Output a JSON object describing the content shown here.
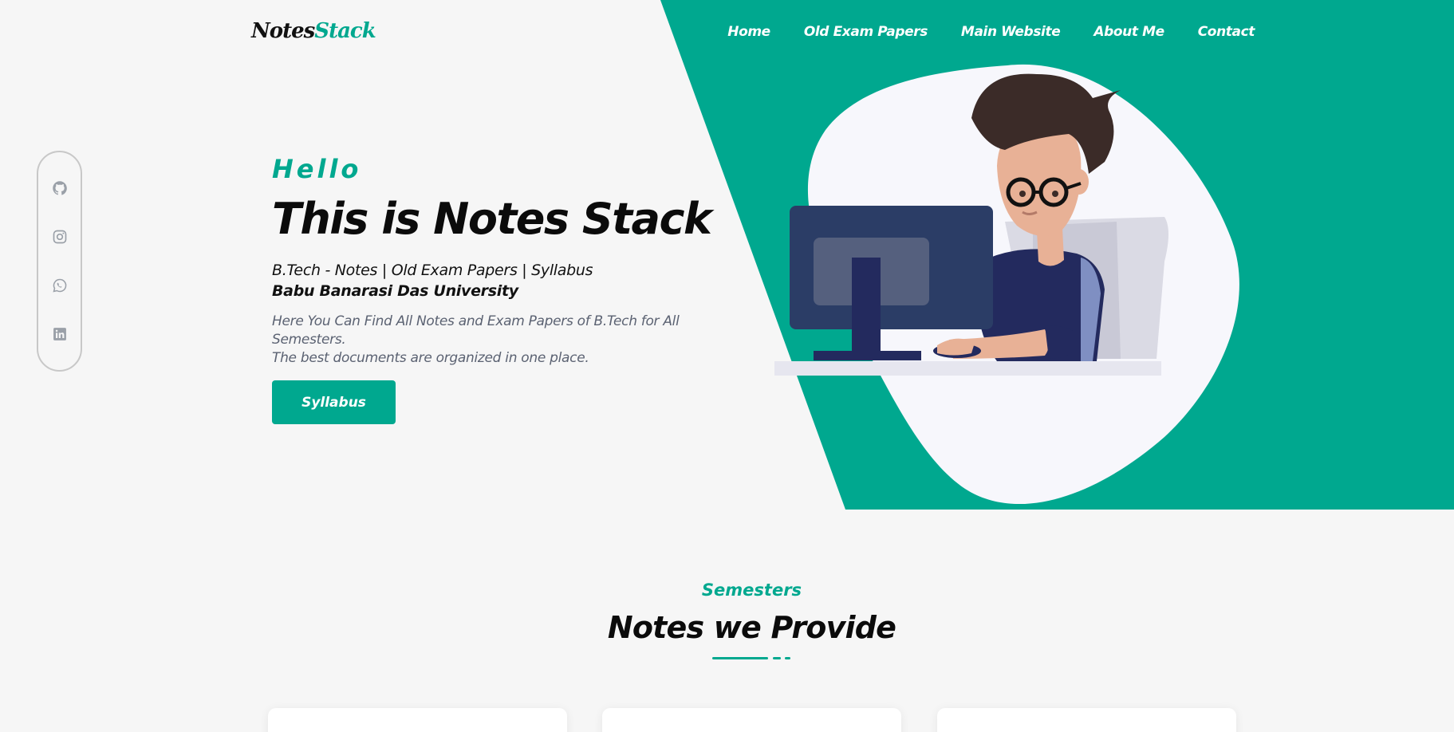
{
  "colors": {
    "accent": "#00a88f",
    "background": "#f6f6f6",
    "blob": "#f7f7fc"
  },
  "logo": {
    "part1": "Notes",
    "part2": "Stack"
  },
  "nav": {
    "items": [
      "Home",
      "Old Exam Papers",
      "Main Website",
      "About Me",
      "Contact"
    ]
  },
  "social": {
    "icons": [
      "github-icon",
      "instagram-icon",
      "whatsapp-icon",
      "linkedin-icon"
    ]
  },
  "hero": {
    "greeting": "Hello",
    "title": "This is Notes Stack",
    "subtitle": "B.Tech - Notes | Old Exam Papers | Syllabus",
    "university": "Babu Banarasi Das University",
    "description_line1": "Here You Can Find All Notes and Exam Papers of B.Tech for All Semesters.",
    "description_line2": "The best documents are organized in one place.",
    "button_label": "Syllabus"
  },
  "section": {
    "label": "Semesters",
    "title": "Notes we Provide"
  }
}
